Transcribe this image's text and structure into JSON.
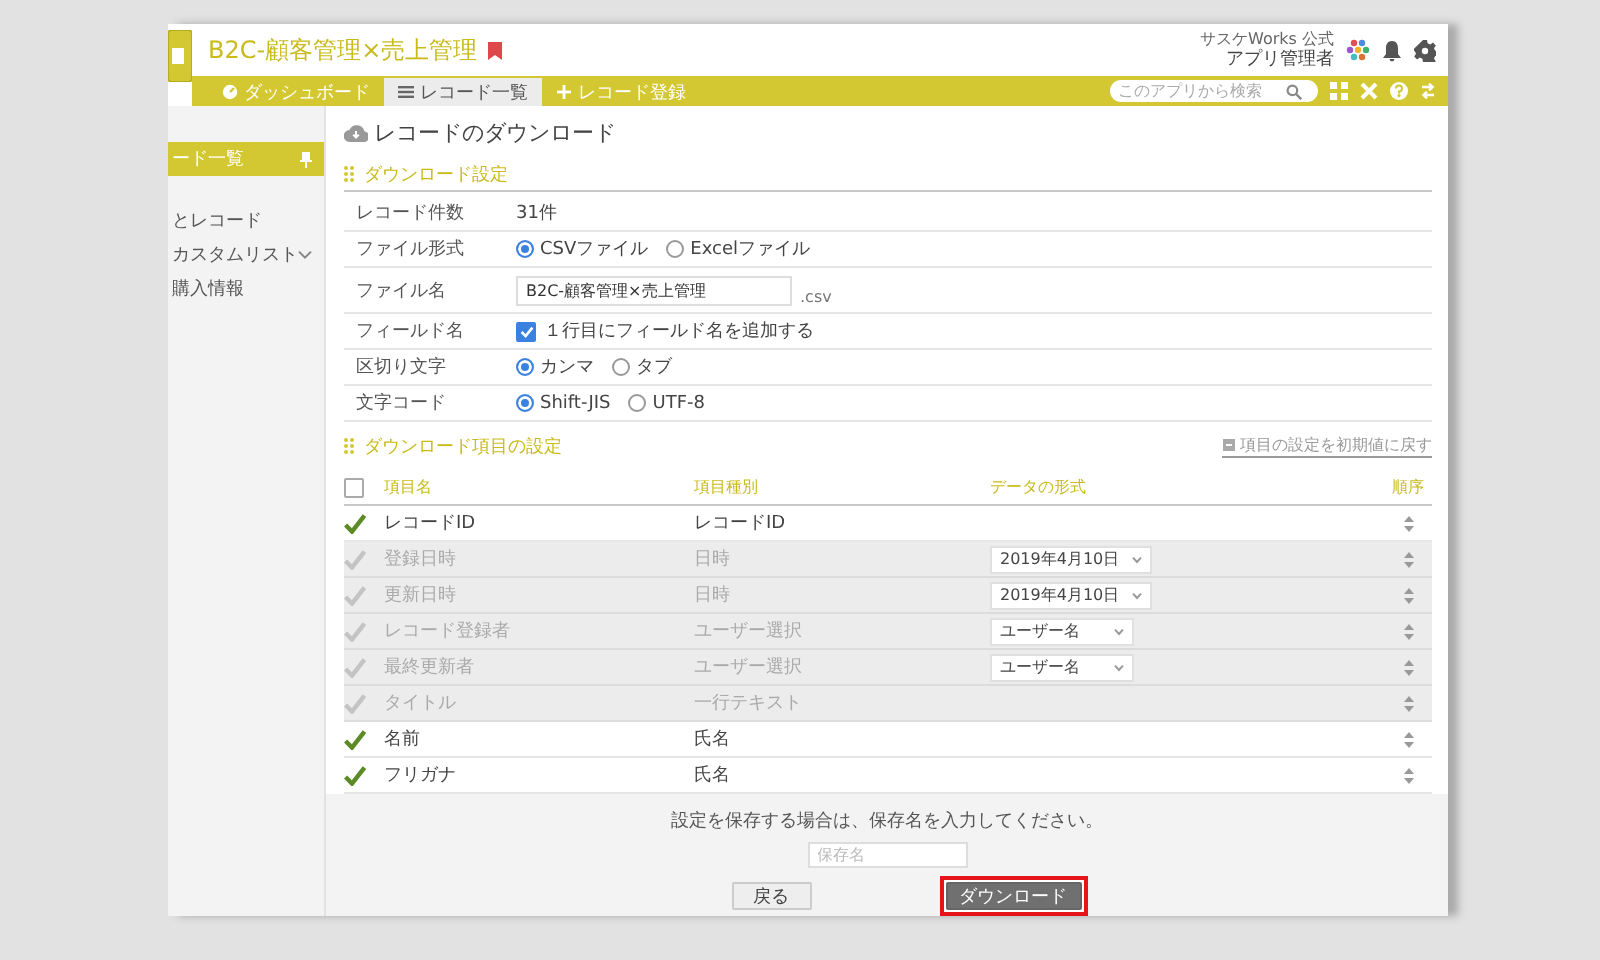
{
  "app": {
    "title": "B2C-顧客管理×売上管理",
    "bookmarked": true
  },
  "user": {
    "org": "サスケWorks 公式",
    "role": "アプリ管理者"
  },
  "nav_tabs": [
    {
      "label": "ダッシュボード",
      "kind": "dashboard",
      "selected": false
    },
    {
      "label": "レコード一覧",
      "kind": "list",
      "selected": true
    },
    {
      "label": "レコード登録",
      "kind": "add",
      "selected": false
    }
  ],
  "search": {
    "placeholder": "このアプリから検索"
  },
  "sidebar": {
    "items": [
      {
        "label": "ード一覧",
        "kind": "link",
        "selected": true
      },
      {
        "label": "とレコード",
        "kind": "link",
        "selected": false
      },
      {
        "label": "カスタムリスト",
        "kind": "group",
        "selected": false
      },
      {
        "label": "購入情報",
        "kind": "link",
        "selected": false
      }
    ]
  },
  "page_title": "レコードのダウンロード",
  "download_settings": {
    "heading": "ダウンロード設定",
    "rows": [
      {
        "label": "レコード件数",
        "kind": "text",
        "value": "31件"
      },
      {
        "label": "ファイル形式",
        "kind": "radio",
        "options": [
          {
            "label": "CSVファイル",
            "selected": true
          },
          {
            "label": "Excelファイル",
            "selected": false
          }
        ]
      },
      {
        "label": "ファイル名",
        "kind": "input",
        "value": "B2C-顧客管理×売上管理",
        "suffix": ".csv"
      },
      {
        "label": "フィールド名",
        "kind": "checkbox",
        "checked": true,
        "text": "１行目にフィールド名を追加する"
      },
      {
        "label": "区切り文字",
        "kind": "radio",
        "options": [
          {
            "label": "カンマ",
            "selected": true
          },
          {
            "label": "タブ",
            "selected": false
          }
        ]
      },
      {
        "label": "文字コード",
        "kind": "radio",
        "options": [
          {
            "label": "Shift-JIS",
            "selected": true
          },
          {
            "label": "UTF-8",
            "selected": false
          }
        ]
      }
    ]
  },
  "item_settings": {
    "heading": "ダウンロード項目の設定",
    "reset_link": "項目の設定を初期値に戻す",
    "select_all_checked": false,
    "columns": [
      "項目名",
      "項目種別",
      "データの形式",
      "順序"
    ],
    "rows": [
      {
        "name": "レコードID",
        "type": "レコードID",
        "checked": true,
        "disabled": false
      },
      {
        "name": "登録日時",
        "type": "日時",
        "checked": true,
        "disabled": true,
        "format": "2019年4月10日"
      },
      {
        "name": "更新日時",
        "type": "日時",
        "checked": true,
        "disabled": true,
        "format": "2019年4月10日"
      },
      {
        "name": "レコード登録者",
        "type": "ユーザー選択",
        "checked": true,
        "disabled": true,
        "format": "ユーザー名"
      },
      {
        "name": "最終更新者",
        "type": "ユーザー選択",
        "checked": true,
        "disabled": true,
        "format": "ユーザー名"
      },
      {
        "name": "タイトル",
        "type": "一行テキスト",
        "checked": true,
        "disabled": true
      },
      {
        "name": "名前",
        "type": "氏名",
        "checked": true,
        "disabled": false
      },
      {
        "name": "フリガナ",
        "type": "氏名",
        "checked": true,
        "disabled": false
      }
    ]
  },
  "footer": {
    "message": "設定を保存する場合は、保存名を入力してください。",
    "save_name": {
      "placeholder": "保存名"
    },
    "buttons": [
      {
        "label": "戻る",
        "kind": "secondary",
        "highlighted": false
      },
      {
        "label": "ダウンロード",
        "kind": "primary",
        "highlighted": true
      }
    ]
  }
}
